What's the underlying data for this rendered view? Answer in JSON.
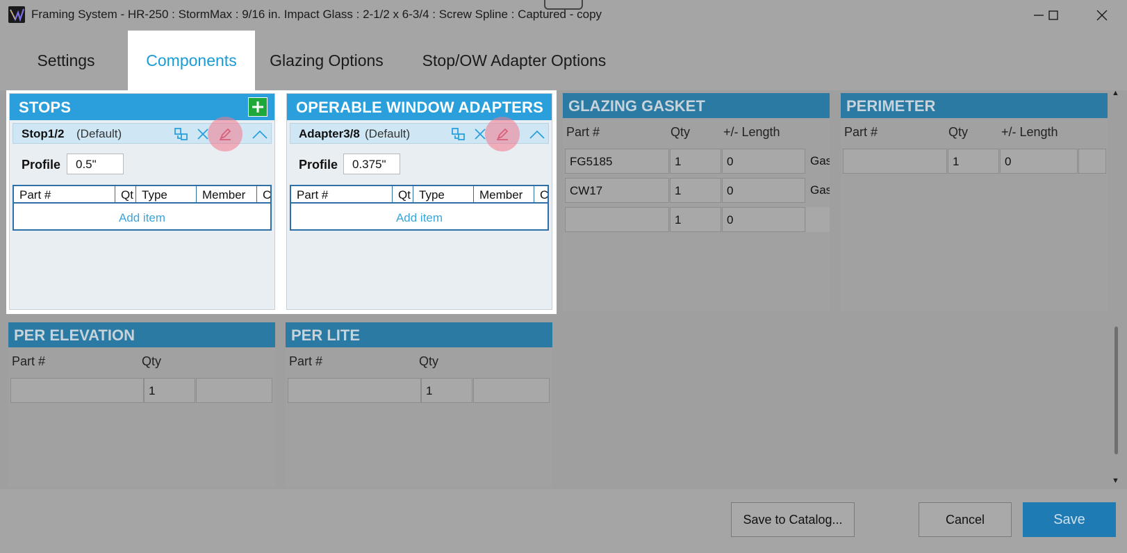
{
  "window": {
    "title": "Framing System - HR-250 : StormMax : 9/16 in. Impact Glass : 2-1/2 x 6-3/4 : Screw Spline : Captured - copy",
    "minimize_icon": "minimize-icon",
    "maximize_icon": "maximize-icon",
    "close_icon": "close-icon"
  },
  "tabs": [
    {
      "label": "Settings",
      "active": false
    },
    {
      "label": "Components",
      "active": true
    },
    {
      "label": "Glazing Options",
      "active": false
    },
    {
      "label": "Stop/OW Adapter Options",
      "active": false
    }
  ],
  "stops": {
    "title": "STOPS",
    "item_name": "Stop1/2",
    "item_default": "(Default)",
    "profile_label": "Profile",
    "profile_value": "0.5\"",
    "columns": [
      "Part #",
      "Qt",
      "Type",
      "Member",
      "C"
    ],
    "add_item": "Add item"
  },
  "adapters": {
    "title": "OPERABLE WINDOW ADAPTERS",
    "item_name": "Adapter3/8",
    "item_default": "(Default)",
    "profile_label": "Profile",
    "profile_value": "0.375\"",
    "columns": [
      "Part #",
      "Qt",
      "Type",
      "Member",
      "C"
    ],
    "add_item": "Add item"
  },
  "glazing_gasket": {
    "title": "GLAZING GASKET",
    "columns": [
      "Part #",
      "Qty",
      "+/- Length"
    ],
    "rows": [
      {
        "part": "FG5185",
        "qty": "1",
        "length": "0",
        "extra": "Gask"
      },
      {
        "part": "CW17",
        "qty": "1",
        "length": "0",
        "extra": "Gask"
      },
      {
        "part": "",
        "qty": "1",
        "length": "0",
        "extra": ""
      }
    ]
  },
  "perimeter": {
    "title": "PERIMETER",
    "columns": [
      "Part #",
      "Qty",
      "+/- Length"
    ],
    "rows": [
      {
        "part": "",
        "qty": "1",
        "length": "0"
      }
    ]
  },
  "per_elevation": {
    "title": "PER ELEVATION",
    "columns": [
      "Part #",
      "Qty"
    ],
    "rows": [
      {
        "part": "",
        "qty": "1"
      }
    ]
  },
  "per_lite": {
    "title": "PER LITE",
    "columns": [
      "Part #",
      "Qty"
    ],
    "rows": [
      {
        "part": "",
        "qty": "1"
      }
    ]
  },
  "footer": {
    "save_to_catalog": "Save to Catalog...",
    "cancel": "Cancel",
    "save": "Save"
  },
  "colors": {
    "accent": "#2a9fdb",
    "add_green": "#1fa83a",
    "primary_button": "#1f7bb4"
  }
}
